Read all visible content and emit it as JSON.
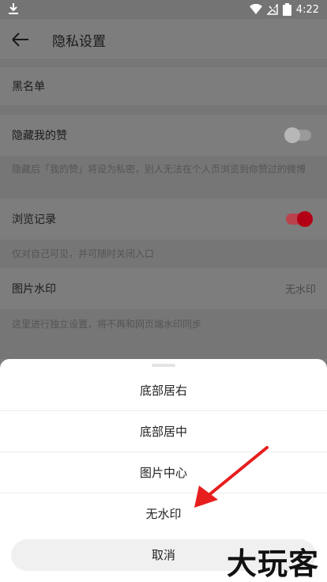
{
  "status": {
    "time": "4:22",
    "battery": "2"
  },
  "header": {
    "title": "隐私设置"
  },
  "settings": {
    "blacklist": {
      "label": "黑名单"
    },
    "hide_likes": {
      "label": "隐藏我的赞",
      "enabled": false,
      "hint": "隐藏后「我的赞」将设为私密，别人无法在个人页浏览到你赞过的微博"
    },
    "browse_history": {
      "label": "浏览记录",
      "enabled": true,
      "hint": "仅对自己可见，并可随时关闭入口"
    },
    "watermark": {
      "label": "图片水印",
      "value": "无水印",
      "hint": "这里进行独立设置，将不再和网页端水印同步"
    }
  },
  "sheet": {
    "options": [
      "底部居右",
      "底部居中",
      "图片中心",
      "无水印"
    ],
    "cancel_label": "取消"
  },
  "overlay_watermark": "大玩客",
  "colors": {
    "accent": "#b40014",
    "arrow": "#e61e1e"
  }
}
